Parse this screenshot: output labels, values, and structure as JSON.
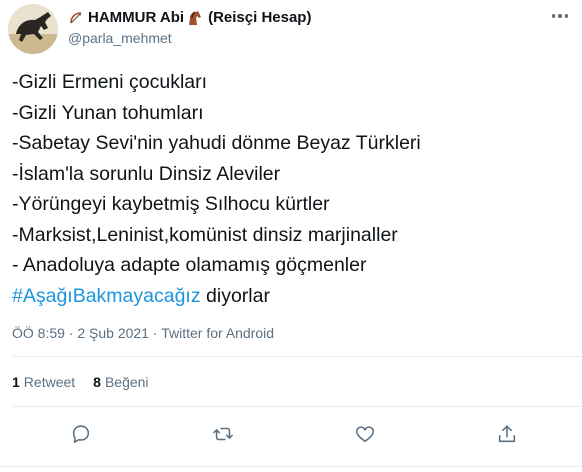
{
  "author": {
    "name": "HAMMUR Abi",
    "bio_suffix": "(Reisçi Hesap)",
    "handle": "@parla_mehmet"
  },
  "tweet": {
    "lines": [
      "-Gizli Ermeni çocukları",
      "-Gizli Yunan tohumları",
      "-Sabetay Sevi'nin yahudi dönme Beyaz Türkleri",
      "-İslam'la sorunlu Dinsiz Aleviler",
      "-Yörüngeyi kaybetmiş Sılhocu kürtler",
      "-Marksist,Leninist,komünist dinsiz marjinaller",
      "- Anadoluya adapte olamamış göçmenler"
    ],
    "hashtag": "#AşağıBakmayacağız",
    "tail": " diyorlar"
  },
  "meta": {
    "time": "ÖÖ 8:59",
    "dot1": " · ",
    "date": "2 Şub 2021",
    "dot2": " · ",
    "source": "Twitter for Android"
  },
  "stats": {
    "retweets": "1",
    "retweets_label": "Retweet",
    "likes": "8",
    "likes_label": "Beğeni"
  },
  "icons": {
    "reply": "reply-icon",
    "retweet": "retweet-icon",
    "like": "heart-icon",
    "share": "share-icon",
    "more": "more-icon"
  },
  "colors": {
    "hashtag": "#1b95e0",
    "secondary": "#5b7083",
    "text": "#0f1419"
  }
}
